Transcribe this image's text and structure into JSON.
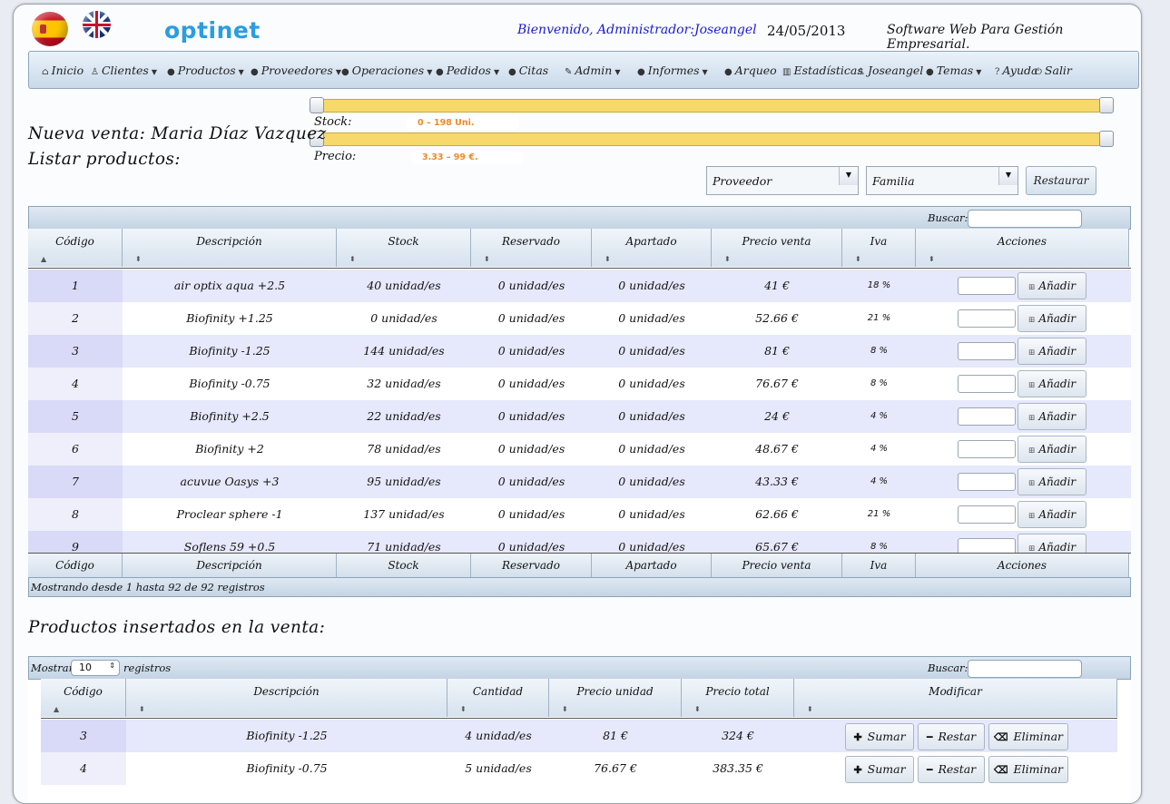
{
  "header": {
    "logo": "optinet",
    "welcome": "Bienvenido, Administrador:Joseangel",
    "date": "24/05/2013",
    "tagline": "Software Web Para Gestión Empresarial."
  },
  "nav": [
    {
      "label": "Inicio",
      "icon": "home-icon",
      "glyph": "⌂",
      "dropdown": false
    },
    {
      "label": "Clientes",
      "icon": "user-icon",
      "glyph": "♙",
      "dropdown": true
    },
    {
      "label": "Productos",
      "icon": "bullet-icon",
      "glyph": "●",
      "dropdown": true
    },
    {
      "label": "Proveedores",
      "icon": "bullet-icon",
      "glyph": "●",
      "dropdown": true
    },
    {
      "label": "Operaciones",
      "icon": "bullet-icon",
      "glyph": "●",
      "dropdown": true
    },
    {
      "label": "Pedidos",
      "icon": "bullet-icon",
      "glyph": "●",
      "dropdown": true
    },
    {
      "label": "Citas",
      "icon": "bullet-icon",
      "glyph": "●",
      "dropdown": false
    },
    {
      "label": "Admin",
      "icon": "wrench-icon",
      "glyph": "✎",
      "dropdown": true
    },
    {
      "label": "Informes",
      "icon": "bullet-icon",
      "glyph": "●",
      "dropdown": true
    },
    {
      "label": "Arqueo",
      "icon": "bullet-icon",
      "glyph": "●",
      "dropdown": false
    },
    {
      "label": "Estadísticas",
      "icon": "chart-icon",
      "glyph": "▥",
      "dropdown": false
    },
    {
      "label": "Joseangel",
      "icon": "user-icon",
      "glyph": "♙",
      "dropdown": false
    },
    {
      "label": "Temas",
      "icon": "bullet-icon",
      "glyph": "●",
      "dropdown": true
    },
    {
      "label": "Ayuda",
      "icon": "help-icon",
      "glyph": "?",
      "dropdown": false
    },
    {
      "label": "Salir",
      "icon": "power-icon",
      "glyph": "⏻",
      "dropdown": false
    }
  ],
  "filters": {
    "stock_label": "Stock:",
    "stock_value": "0 – 198 Uni.",
    "price_label": "Precio:",
    "price_value": "3.33 – 99 €.",
    "proveedor": "Proveedor",
    "familia": "Familia",
    "restore": "Restaurar"
  },
  "headings": {
    "new_sale": "Nueva venta: Maria Díaz Vazquez",
    "list_products": "Listar productos:",
    "inserted": "Productos insertados en la venta:"
  },
  "products_table": {
    "search_label": "Buscar:",
    "columns": [
      "Código",
      "Descripción",
      "Stock",
      "Reservado",
      "Apartado",
      "Precio venta",
      "Iva",
      "Acciones"
    ],
    "add_label": "Añadir",
    "rows": [
      {
        "code": "1",
        "desc": "air optix aqua +2.5",
        "stock": "40 unidad/es",
        "reserved": "0 unidad/es",
        "apart": "0 unidad/es",
        "price": "41 €",
        "iva": "18 %"
      },
      {
        "code": "2",
        "desc": "Biofinity +1.25",
        "stock": "0 unidad/es",
        "reserved": "0 unidad/es",
        "apart": "0 unidad/es",
        "price": "52.66 €",
        "iva": "21 %"
      },
      {
        "code": "3",
        "desc": "Biofinity -1.25",
        "stock": "144 unidad/es",
        "reserved": "0 unidad/es",
        "apart": "0 unidad/es",
        "price": "81 €",
        "iva": "8 %"
      },
      {
        "code": "4",
        "desc": "Biofinity -0.75",
        "stock": "32 unidad/es",
        "reserved": "0 unidad/es",
        "apart": "0 unidad/es",
        "price": "76.67 €",
        "iva": "8 %"
      },
      {
        "code": "5",
        "desc": "Biofinity +2.5",
        "stock": "22 unidad/es",
        "reserved": "0 unidad/es",
        "apart": "0 unidad/es",
        "price": "24 €",
        "iva": "4 %"
      },
      {
        "code": "6",
        "desc": "Biofinity +2",
        "stock": "78 unidad/es",
        "reserved": "0 unidad/es",
        "apart": "0 unidad/es",
        "price": "48.67 €",
        "iva": "4 %"
      },
      {
        "code": "7",
        "desc": "acuvue Oasys +3",
        "stock": "95 unidad/es",
        "reserved": "0 unidad/es",
        "apart": "0 unidad/es",
        "price": "43.33 €",
        "iva": "4 %"
      },
      {
        "code": "8",
        "desc": "Proclear sphere -1",
        "stock": "137 unidad/es",
        "reserved": "0 unidad/es",
        "apart": "0 unidad/es",
        "price": "62.66 €",
        "iva": "21 %"
      },
      {
        "code": "9",
        "desc": "Soflens 59 +0.5",
        "stock": "71 unidad/es",
        "reserved": "0 unidad/es",
        "apart": "0 unidad/es",
        "price": "65.67 €",
        "iva": "8 %"
      }
    ],
    "footer_text": "Mostrando desde 1 hasta 92 de 92 registros"
  },
  "sale_table": {
    "show_label": "Mostrar",
    "show_value": "10",
    "records_label": "registros",
    "search_label": "Buscar:",
    "columns": [
      "Código",
      "Descripción",
      "Cantidad",
      "Precio unidad",
      "Precio total",
      "Modificar"
    ],
    "sumar": "Sumar",
    "restar": "Restar",
    "eliminar": "Eliminar",
    "rows": [
      {
        "code": "3",
        "desc": "Biofinity -1.25",
        "qty": "4 unidad/es",
        "unit": "81 €",
        "total": "324 €"
      },
      {
        "code": "4",
        "desc": "Biofinity -0.75",
        "qty": "5 unidad/es",
        "unit": "76.67 €",
        "total": "383.35 €"
      }
    ]
  }
}
